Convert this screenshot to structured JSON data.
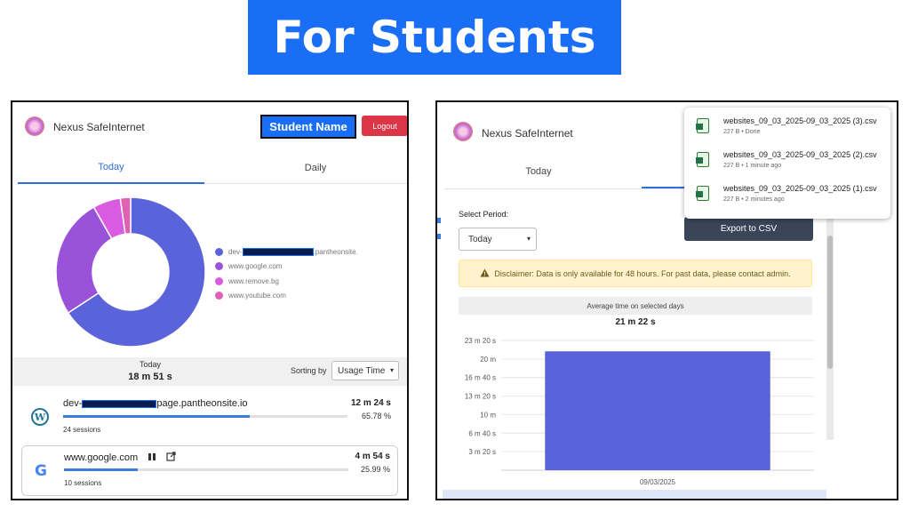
{
  "banner": {
    "title": "For Students"
  },
  "left_panel": {
    "app_name": "Nexus SafeInternet",
    "student_name": "Student Name",
    "logout_label": "Logout",
    "tabs": [
      {
        "label": "Today",
        "active": true
      },
      {
        "label": "Daily",
        "active": false
      }
    ],
    "donut": {
      "slices": [
        {
          "label_prefix": "dev-",
          "label_suffix": ".pantheonsite.",
          "percent": 65.78,
          "color": "#5b63db"
        },
        {
          "label": "www.google.com",
          "percent": 25.99,
          "color": "#9a52d8"
        },
        {
          "label": "www.remove.bg",
          "percent": 6.0,
          "color": "#d85be0"
        },
        {
          "label": "www.youtube.com",
          "percent": 2.23,
          "color": "#e060b4"
        }
      ]
    },
    "summary": {
      "label": "Today",
      "total": "18 m 51 s",
      "sorting_label": "Sorting by",
      "sort_value": "Usage Time"
    },
    "sites": [
      {
        "name_prefix": "dev-",
        "name_suffix": "page.pantheonsite.io",
        "time": "12 m 24 s",
        "percent_label": "65.78 %",
        "percent": 65.78,
        "sessions": "24 sessions",
        "icon": "wordpress-icon"
      },
      {
        "name": "www.google.com",
        "time": "4 m 54 s",
        "percent_label": "25.99 %",
        "percent": 25.99,
        "sessions": "10 sessions",
        "icon": "google-icon"
      }
    ]
  },
  "right_panel": {
    "app_name": "Nexus SafeInternet",
    "tabs": [
      {
        "label": "Today",
        "active": false
      }
    ],
    "select_period_label": "Select Period:",
    "period_value": "Today",
    "export_label": "Export to CSV",
    "disclaimer": "Disclaimer: Data is only available for 48 hours. For past data, please contact admin.",
    "avg_label": "Average time on selected days",
    "avg_value": "21 m 22 s",
    "downloads": [
      {
        "file": "websites_09_03_2025-09_03_2025 (3).csv",
        "meta": "227 B • Done"
      },
      {
        "file": "websites_09_03_2025-09_03_2025 (2).csv",
        "meta": "227 B • 1 minute ago"
      },
      {
        "file": "websites_09_03_2025-09_03_2025 (1).csv",
        "meta": "227 B • 2 minutes ago"
      }
    ]
  },
  "chart_data": {
    "type": "bar",
    "categories": [
      "09/03/2025"
    ],
    "values": [
      21.37
    ],
    "y_tick_labels": [
      "3 m 20 s",
      "6 m 40 s",
      "10 m",
      "13 m 20 s",
      "16 m 40 s",
      "20 m",
      "23 m 20 s"
    ],
    "y_unit": "minutes",
    "ylim": [
      0,
      23.33
    ],
    "bar_color": "#5b63db",
    "grid": true
  }
}
